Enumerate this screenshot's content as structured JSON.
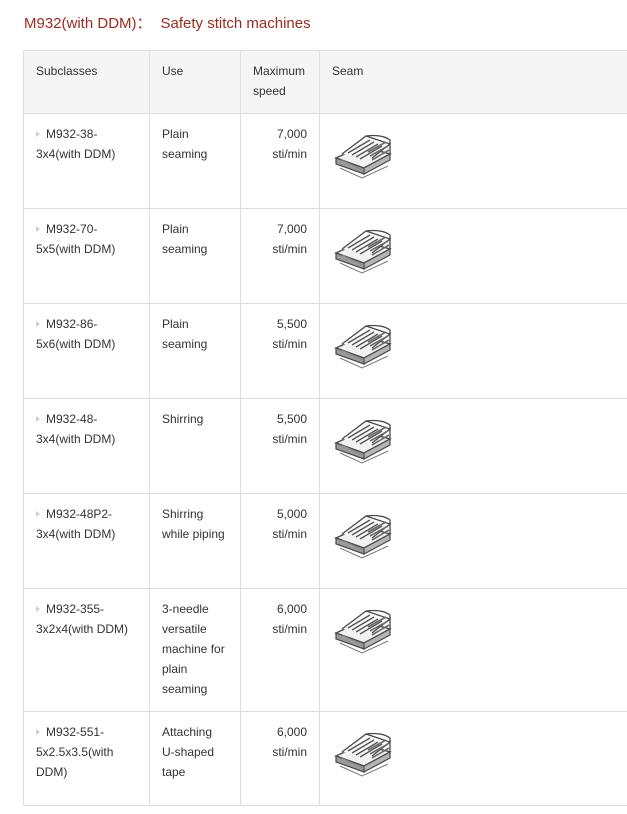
{
  "title": {
    "model": "M932(with DDM)",
    "separator": "：",
    "category": "Safety stitch machines"
  },
  "table": {
    "headers": [
      "Subclasses",
      "Use",
      "Maximum speed",
      "Seam"
    ],
    "rows": [
      {
        "subclass": "M932-38-3x4(with DDM)",
        "use": "Plain seaming",
        "speed": "7,000 sti/min",
        "seam_icon": "seam-diagram-icon"
      },
      {
        "subclass": "M932-70-5x5(with DDM)",
        "use": "Plain seaming",
        "speed": "7,000 sti/min",
        "seam_icon": "seam-diagram-icon"
      },
      {
        "subclass": "M932-86-5x6(with DDM)",
        "use": "Plain seaming",
        "speed": "5,500 sti/min",
        "seam_icon": "seam-diagram-icon"
      },
      {
        "subclass": "M932-48-3x4(with DDM)",
        "use": "Shirring",
        "speed": "5,500 sti/min",
        "seam_icon": "seam-diagram-icon"
      },
      {
        "subclass": "M932-48P2-3x4(with DDM)",
        "use": "Shirring while piping",
        "speed": "5,000 sti/min",
        "seam_icon": "seam-diagram-icon"
      },
      {
        "subclass": "M932-355-3x2x4(with DDM)",
        "use": "3-needle versatile machine for plain seaming",
        "speed": "6,000 sti/min",
        "seam_icon": "seam-diagram-icon"
      },
      {
        "subclass": "M932-551-5x2.5x3.5(with DDM)",
        "use": "Attaching U-shaped tape",
        "speed": "6,000 sti/min",
        "seam_icon": "seam-diagram-icon"
      }
    ]
  }
}
